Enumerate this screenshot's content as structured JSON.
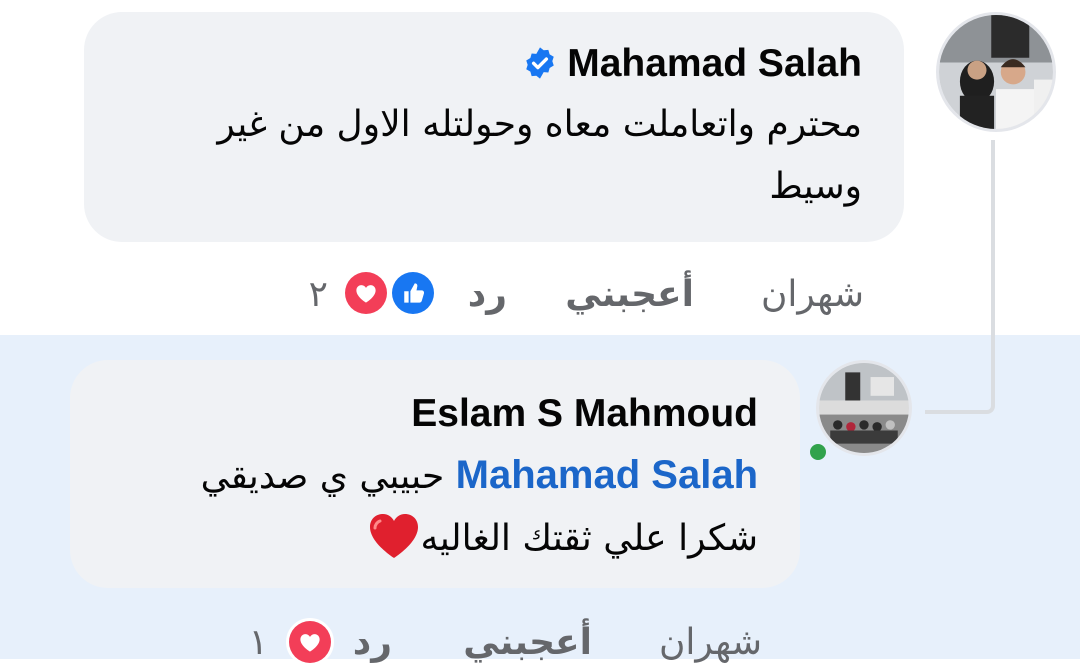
{
  "comment": {
    "author": "Mahamad Salah",
    "verified": true,
    "text_line1": "محترم واتعاملت معاه وحولتله الاول من غير",
    "text_line2": "وسيط",
    "time": "شهران",
    "like_label": "أعجبني",
    "reply_label": "رد",
    "reaction_count": "٢",
    "reactions": [
      "like-icon",
      "love-icon"
    ]
  },
  "reply": {
    "author": "Eslam S Mahmoud",
    "mention": "Mahamad Salah",
    "text_line1": "حبيبي ي صديقي",
    "text_line2": "شكرا علي ثقتك الغاليه",
    "emoji": "red-heart-emoji",
    "time": "شهران",
    "like_label": "أعجبني",
    "reply_label": "رد",
    "reaction_count": "١",
    "reactions": [
      "love-icon"
    ],
    "online": true
  },
  "colors": {
    "mention": "#1b66c9",
    "like": "#1877f2",
    "love": "#f33e58",
    "online": "#31a24c",
    "reply_background": "#e7f0fb"
  }
}
